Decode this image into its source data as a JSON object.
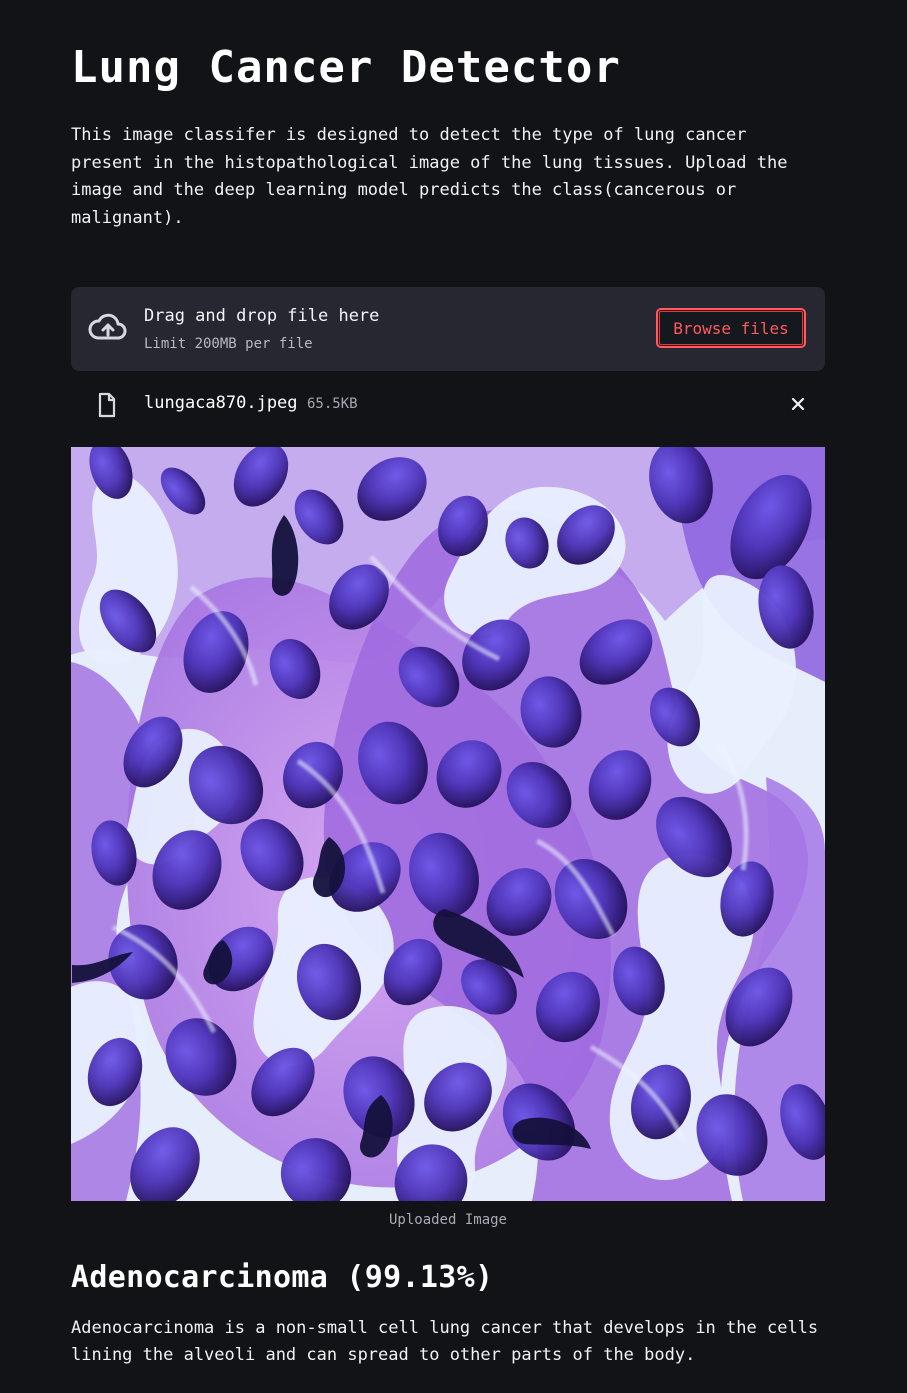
{
  "page": {
    "title": "Lung Cancer Detector",
    "description": "This image classifer is designed to detect the type of lung cancer present in the histopathological image of the lung tissues. Upload the image and the deep learning model predicts the class(cancerous or malignant)."
  },
  "uploader": {
    "drag_text": "Drag and drop file here",
    "limit_text": "Limit 200MB per file",
    "browse_label": "Browse files",
    "icon": "cloud-upload-icon",
    "accent_color": "#ff4b4b"
  },
  "uploaded_file": {
    "name": "lungaca870.jpeg",
    "size": "65.5KB",
    "file_icon": "file-icon",
    "remove_icon": "close-icon"
  },
  "image": {
    "caption": "Uploaded Image",
    "content": "histopathological lung tissue image"
  },
  "result": {
    "title": "Adenocarcinoma (99.13%)",
    "description": "Adenocarcinoma is a non-small cell lung cancer that develops in the cells lining the alveoli and can spread to other parts of the body."
  }
}
